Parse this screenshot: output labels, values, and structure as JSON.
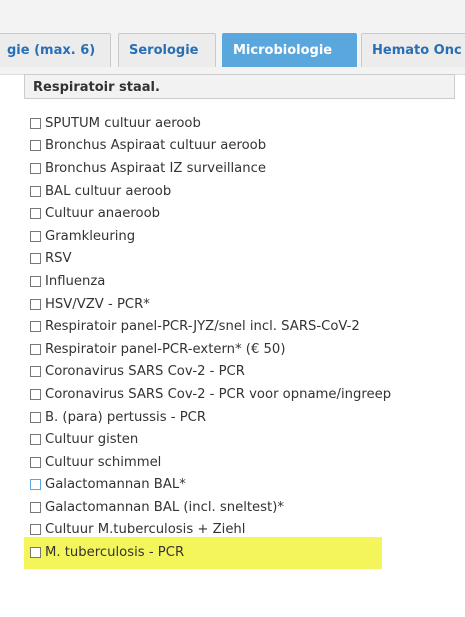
{
  "tabs": [
    {
      "label": "gie (max. 6)"
    },
    {
      "label": "Serologie"
    },
    {
      "label": "Microbiologie",
      "active": true
    },
    {
      "label": "Hemato Onc"
    }
  ],
  "section": {
    "title": "Respiratoir staal."
  },
  "items": [
    {
      "label": "SPUTUM cultuur aeroob"
    },
    {
      "label": "Bronchus Aspiraat cultuur aeroob"
    },
    {
      "label": "Bronchus Aspiraat IZ surveillance"
    },
    {
      "label": "BAL cultuur aeroob"
    },
    {
      "label": "Cultuur anaeroob"
    },
    {
      "label": "Gramkleuring"
    },
    {
      "label": "RSV"
    },
    {
      "label": "Influenza"
    },
    {
      "label": "HSV/VZV - PCR*"
    },
    {
      "label": "Respiratoir panel-PCR-JYZ/snel incl. SARS-CoV-2"
    },
    {
      "label": "Respiratoir panel-PCR-extern* (€ 50)"
    },
    {
      "label": "Coronavirus SARS Cov-2 - PCR"
    },
    {
      "label": "Coronavirus SARS Cov-2 - PCR voor opname/ingreep"
    },
    {
      "label": "B. (para) pertussis - PCR"
    },
    {
      "label": "Cultuur gisten"
    },
    {
      "label": "Cultuur schimmel"
    },
    {
      "label": "Galactomannan BAL*"
    },
    {
      "label": "Galactomannan BAL (incl. sneltest)*",
      "highlighted": true
    },
    {
      "label": "Cultuur M.tuberculosis + Ziehl"
    },
    {
      "label": "M. tuberculosis - PCR"
    }
  ],
  "colors": {
    "accent": "#5aa7dd",
    "highlight": "#f4f55a",
    "tab_text": "#2a6fb3"
  }
}
